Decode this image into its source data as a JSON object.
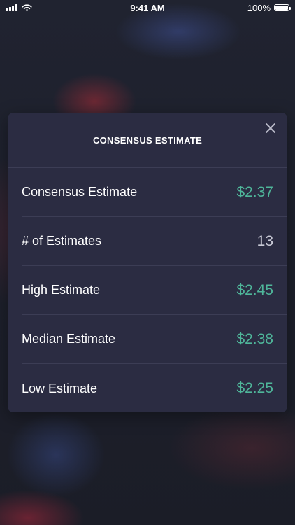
{
  "status_bar": {
    "time": "9:41 AM",
    "battery": "100%"
  },
  "card": {
    "title": "CONSENSUS ESTIMATE",
    "close_icon": "close-icon",
    "rows": [
      {
        "label": "Consensus Estimate",
        "value": "$2.37",
        "color": "#4fb69a"
      },
      {
        "label": "# of Estimates",
        "value": "13",
        "color": "#c9cad6"
      },
      {
        "label": "High Estimate",
        "value": "$2.45",
        "color": "#4fb69a"
      },
      {
        "label": "Median Estimate",
        "value": "$2.38",
        "color": "#4fb69a"
      },
      {
        "label": "Low Estimate",
        "value": "$2.25",
        "color": "#4fb69a"
      }
    ]
  },
  "colors": {
    "accent_green": "#4fb69a",
    "card_background": "#2b2c42",
    "divider": "#3c3d55"
  }
}
